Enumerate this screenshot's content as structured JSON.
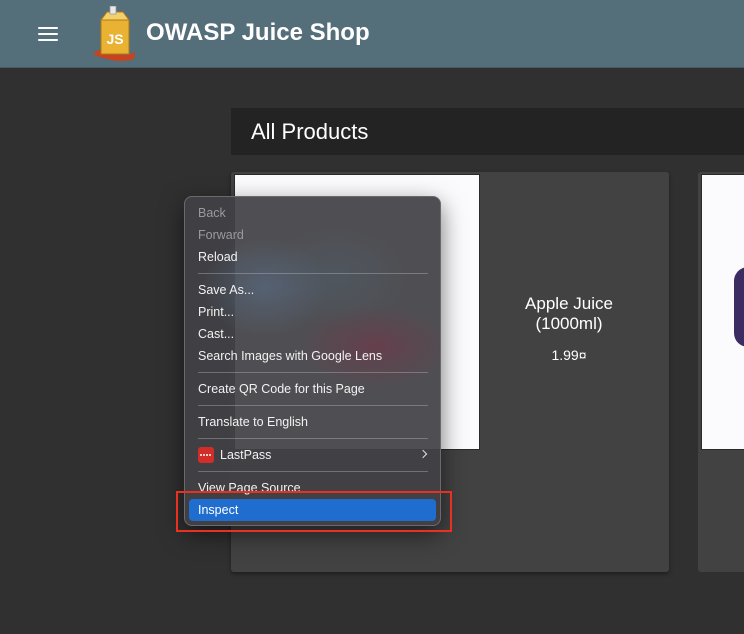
{
  "app": {
    "title": "OWASP Juice Shop",
    "logo_text": "JS"
  },
  "main": {
    "heading": "All Products",
    "products": [
      {
        "name": "Apple Juice (1000ml)",
        "price": "1.99¤"
      }
    ]
  },
  "context_menu": {
    "items": [
      {
        "label": "Back",
        "disabled": true
      },
      {
        "label": "Forward",
        "disabled": true
      },
      {
        "label": "Reload"
      },
      {
        "label": "Save As..."
      },
      {
        "label": "Print..."
      },
      {
        "label": "Cast..."
      },
      {
        "label": "Search Images with Google Lens"
      },
      {
        "label": "Create QR Code for this Page"
      },
      {
        "label": "Translate to English"
      },
      {
        "label": "LastPass",
        "icon": "lastpass-icon",
        "submenu": true
      },
      {
        "label": "View Page Source"
      },
      {
        "label": "Inspect",
        "highlighted": true
      }
    ]
  },
  "colors": {
    "toolbar": "#546e7a",
    "background": "#303030",
    "card": "#424242",
    "menu_highlight": "#1f6ecf",
    "annotation_box": "#e8311f",
    "lastpass": "#d32d27"
  }
}
